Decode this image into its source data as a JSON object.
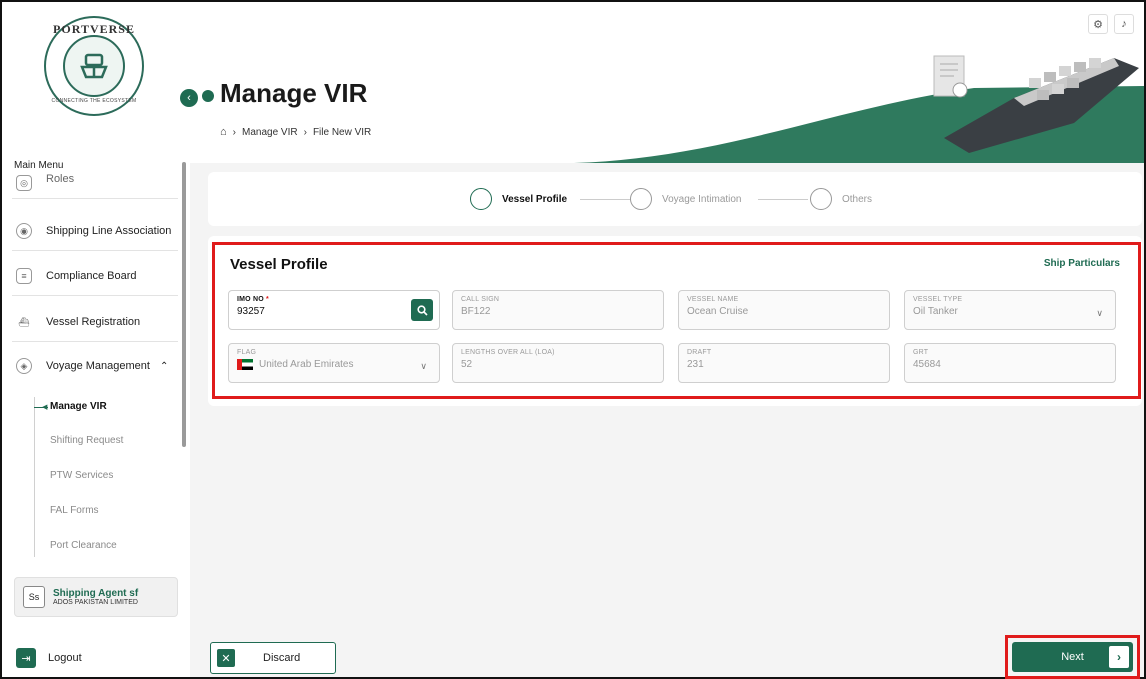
{
  "brand": {
    "logo_top": "PORTVERSE",
    "logo_bottom": "CONNECTING THE ECOSYSTEM"
  },
  "sidebar": {
    "main_menu_label": "Main Menu",
    "items": [
      {
        "label": "Roles",
        "icon": "roles-icon"
      },
      {
        "label": "Shipping Line Association",
        "icon": "association-icon"
      },
      {
        "label": "Compliance Board",
        "icon": "document-icon"
      },
      {
        "label": "Vessel Registration",
        "icon": "ship-icon"
      },
      {
        "label": "Voyage Management",
        "icon": "location-pin-icon"
      }
    ],
    "submenu": [
      {
        "label": "Manage VIR"
      },
      {
        "label": "Shifting Request"
      },
      {
        "label": "PTW Services"
      },
      {
        "label": "FAL Forms"
      },
      {
        "label": "Port Clearance"
      }
    ],
    "agent": {
      "initials": "Ss",
      "name": "Shipping Agent sf",
      "org": "ADOS PAKISTAN LIMITED"
    },
    "logout_label": "Logout"
  },
  "header": {
    "title": "Manage VIR",
    "breadcrumb": [
      "Manage VIR",
      "File New VIR"
    ]
  },
  "stepper": {
    "steps": [
      {
        "label": "Vessel Profile",
        "active": true
      },
      {
        "label": "Voyage Intimation",
        "active": false
      },
      {
        "label": "Others",
        "active": false
      }
    ]
  },
  "profile": {
    "title": "Vessel Profile",
    "ship_particulars_link": "Ship Particulars",
    "fields": {
      "imo": {
        "label": "IMO NO",
        "required": "*",
        "value": "93257"
      },
      "call_sign": {
        "label": "CALL SIGN",
        "value": "BF122"
      },
      "vessel_name": {
        "label": "VESSEL NAME",
        "value": "Ocean Cruise"
      },
      "vessel_type": {
        "label": "VESSEL TYPE",
        "value": "Oil Tanker"
      },
      "flag": {
        "label": "FLAG",
        "value": "United Arab Emirates"
      },
      "loa": {
        "label": "LENGTHS OVER ALL (LOA)",
        "value": "52"
      },
      "draft": {
        "label": "DRAFT",
        "value": "231"
      },
      "grt": {
        "label": "GRT",
        "value": "45684"
      }
    }
  },
  "footer": {
    "discard_label": "Discard",
    "next_label": "Next"
  },
  "colors": {
    "brand_green": "#1f6b52",
    "highlight_red": "#e01b1b"
  }
}
